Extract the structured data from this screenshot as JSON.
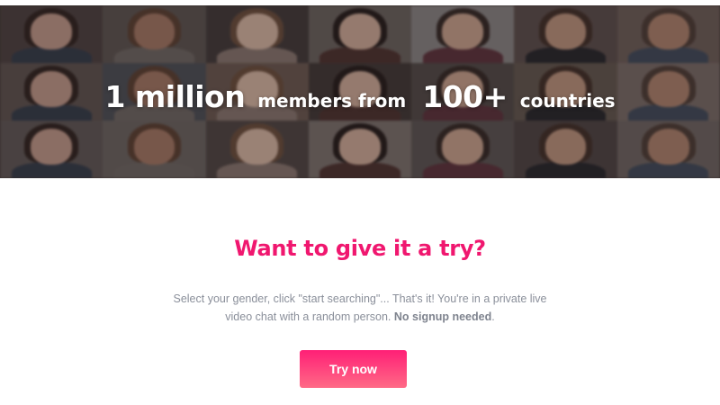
{
  "hero": {
    "stat_members": "1 million",
    "text_members": "members from",
    "stat_countries": "100+",
    "text_countries": "countries"
  },
  "cta": {
    "title": "Want to give it a try?",
    "description": "Select your gender, click \"start searching\"... That's it! You're in a private live video chat with a random person.",
    "description_emphasis": "No signup needed",
    "description_end": ".",
    "button_label": "Try now"
  },
  "colors": {
    "accent": "#f0176f",
    "button_top": "#ff1f76",
    "button_bottom": "#ff6a86",
    "body_text": "#8a8f9a"
  }
}
